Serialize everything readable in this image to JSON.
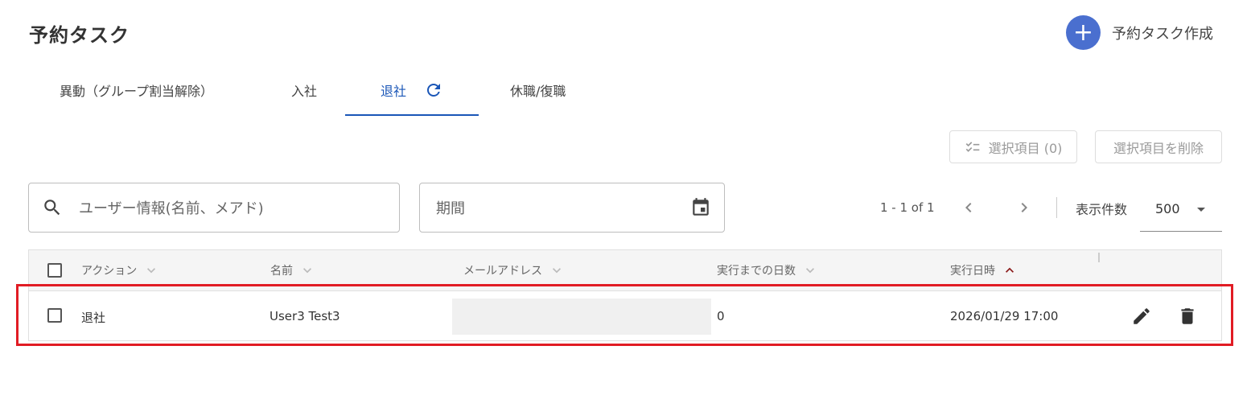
{
  "header": {
    "title": "予約タスク",
    "create_label": "予約タスク作成"
  },
  "tabs": [
    {
      "label": "異動（グループ割当解除）"
    },
    {
      "label": "入社"
    },
    {
      "label": "退社"
    },
    {
      "label": "休職/復職"
    }
  ],
  "toolbar": {
    "selected_label": "選択項目 (0)",
    "delete_selected_label": "選択項目を削除"
  },
  "filters": {
    "search_placeholder": "ユーザー情報(名前、メアド)",
    "period_label": "期間"
  },
  "pagination": {
    "range": "1 - 1 of 1",
    "per_page_label": "表示件数",
    "per_page_value": "500"
  },
  "table": {
    "columns": [
      "アクション",
      "名前",
      "メールアドレス",
      "実行までの日数",
      "実行日時"
    ],
    "rows": [
      {
        "action": "退社",
        "name": "User3 Test3",
        "email": "",
        "days": "0",
        "datetime": "2026/01/29 17:00"
      }
    ]
  },
  "colors": {
    "accent": "#1a56b7",
    "create_button": "#4a6fcf",
    "highlight": "#e11c24",
    "sort_active": "#8b1a1a"
  },
  "icons": [
    "plus-icon",
    "refresh-icon",
    "checklist-icon",
    "search-icon",
    "calendar-icon",
    "chevron-left-icon",
    "chevron-right-icon",
    "dropdown-arrow-icon",
    "sort-chevron-down-icon",
    "sort-chevron-up-icon",
    "pencil-icon",
    "trash-icon"
  ]
}
